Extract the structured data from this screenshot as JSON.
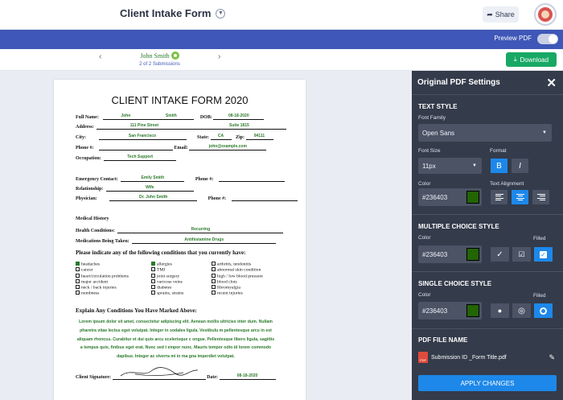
{
  "header": {
    "title": "Client Intake Form",
    "share_label": "Share"
  },
  "bluebar": {
    "preview_label": "Preview PDF"
  },
  "nav": {
    "prev": "‹",
    "next": "›",
    "submitter": "John Smith",
    "submission_count": "2 of 2 Submissions",
    "download_label": "Download"
  },
  "form": {
    "title": "CLIENT INTAKE FORM 2020",
    "labels": {
      "full_name": "Full Name:",
      "dob": "DOB:",
      "address": "Address:",
      "city": "City:",
      "state": "State:",
      "zip": "Zip:",
      "phone": "Phone #:",
      "email": "Email:",
      "occupation": "Occupation:",
      "emergency_contact": "Emergency Contact:",
      "phone2": "Phone #:",
      "relationship": "Relationship:",
      "physician": "Physician:",
      "phone3": "Phone #:",
      "medical_history": "Medical History",
      "health_conditions": "Health Conditions:",
      "medications": "Medications Being Taken:",
      "signature": "Client Signature:",
      "date": "Date:"
    },
    "values": {
      "first_name": "John",
      "last_name": "Smith",
      "dob": "08-18-2020",
      "street": "111 Pine Street",
      "suite": "Suite 1815",
      "city": "San Francisco",
      "state": "CA",
      "zip": "94111",
      "phone": "",
      "email": "john@example.com",
      "occupation": "Tech Support",
      "emergency_contact": "Emily Smith",
      "phone2": "",
      "relationship": "Wife",
      "physician": "Dr. John Smith",
      "phone3": "",
      "health_conditions": "Recurring",
      "medications": "Antihistamine Drugs",
      "date": "08-18-2020"
    },
    "conditions_question": "Please indicate any of the following conditions that you currently have:",
    "conditions_col1": [
      {
        "label": "headaches",
        "checked": true
      },
      {
        "label": "cancer",
        "checked": false
      },
      {
        "label": "heart/circulation problems",
        "checked": false
      },
      {
        "label": "major accident",
        "checked": false
      },
      {
        "label": "neck / back injuries",
        "checked": false
      },
      {
        "label": "numbness",
        "checked": false
      }
    ],
    "conditions_col2": [
      {
        "label": "allergies",
        "checked": true
      },
      {
        "label": "TMJ",
        "checked": false
      },
      {
        "label": "joint surgery",
        "checked": false
      },
      {
        "label": "varicose veins",
        "checked": false
      },
      {
        "label": "diabetes",
        "checked": false
      },
      {
        "label": "sprains, strains",
        "checked": false
      }
    ],
    "conditions_col3": [
      {
        "label": "arthritis, tendonitis",
        "checked": false
      },
      {
        "label": "abnormal skin condition",
        "checked": false
      },
      {
        "label": "high / low blood pressure",
        "checked": false
      },
      {
        "label": "blood clots",
        "checked": false
      },
      {
        "label": "fibromyalgia",
        "checked": false
      },
      {
        "label": "recent injuries",
        "checked": false
      }
    ],
    "explain_heading": "Explain Any Conditions You Have Marked Above:",
    "explain_text": "Lorem ipsum dolor sit amet, consectetur adipiscing elit. Aenean mollis ultricies inter dum. Nullam pharetra vitae lectus eget volutpat. Integer in sodales ligula. Vestibulu m pellentesque arcu in est aliquam rhoncus. Curabitur et dui quis arcu scelerisque c ongue. Pellentesque libero ligula, sagittis a tempus quis, finibus eget erat. Nunc sed t empor nunc. Mauris tempor odio id lorem commodo dapibus. Integer ac viverra mi in ma gna imperdiet volutpat."
  },
  "panel": {
    "title": "Original PDF Settings",
    "text_style": {
      "heading": "TEXT STYLE",
      "font_family_label": "Font Family",
      "font_family": "Open Sans",
      "font_size_label": "Font Size",
      "font_size": "11px",
      "format_label": "Format",
      "bold": "B",
      "italic": "I",
      "color_label": "Color",
      "color": "#236403",
      "text_align_label": "Text Alignment"
    },
    "multiple_choice": {
      "heading": "MULTIPLE CHOICE STYLE",
      "color_label": "Color",
      "filled_label": "Filled",
      "color": "#236403"
    },
    "single_choice": {
      "heading": "SINGLE CHOICE STYLE",
      "color_label": "Color",
      "filled_label": "Filled",
      "color": "#236403"
    },
    "pdf_file": {
      "heading": "PDF FILE NAME",
      "name": "Submission ID _Form Title.pdf",
      "icon_text": "PDF"
    },
    "apply_label": "APPLY CHANGES"
  },
  "colors": {
    "accent": "#3e57b8",
    "download": "#18a865",
    "apply": "#1d88ea",
    "panel_bg": "#343b4a",
    "form_value": "#236403"
  }
}
